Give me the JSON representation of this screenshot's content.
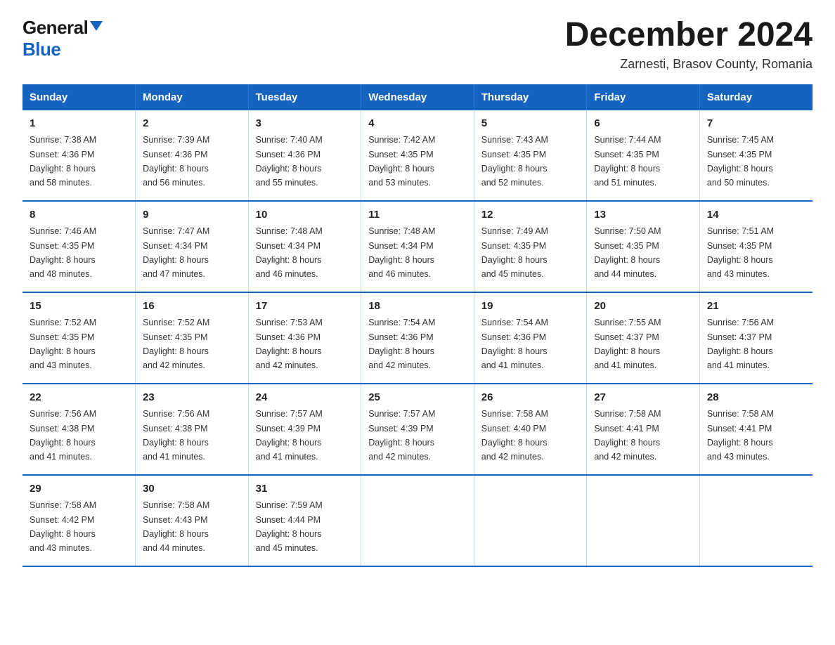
{
  "header": {
    "logo_general": "General",
    "logo_blue": "Blue",
    "title": "December 2024",
    "location": "Zarnesti, Brasov County, Romania"
  },
  "days_of_week": [
    "Sunday",
    "Monday",
    "Tuesday",
    "Wednesday",
    "Thursday",
    "Friday",
    "Saturday"
  ],
  "weeks": [
    [
      {
        "day": "1",
        "sunrise": "7:38 AM",
        "sunset": "4:36 PM",
        "daylight": "8 hours and 58 minutes."
      },
      {
        "day": "2",
        "sunrise": "7:39 AM",
        "sunset": "4:36 PM",
        "daylight": "8 hours and 56 minutes."
      },
      {
        "day": "3",
        "sunrise": "7:40 AM",
        "sunset": "4:36 PM",
        "daylight": "8 hours and 55 minutes."
      },
      {
        "day": "4",
        "sunrise": "7:42 AM",
        "sunset": "4:35 PM",
        "daylight": "8 hours and 53 minutes."
      },
      {
        "day": "5",
        "sunrise": "7:43 AM",
        "sunset": "4:35 PM",
        "daylight": "8 hours and 52 minutes."
      },
      {
        "day": "6",
        "sunrise": "7:44 AM",
        "sunset": "4:35 PM",
        "daylight": "8 hours and 51 minutes."
      },
      {
        "day": "7",
        "sunrise": "7:45 AM",
        "sunset": "4:35 PM",
        "daylight": "8 hours and 50 minutes."
      }
    ],
    [
      {
        "day": "8",
        "sunrise": "7:46 AM",
        "sunset": "4:35 PM",
        "daylight": "8 hours and 48 minutes."
      },
      {
        "day": "9",
        "sunrise": "7:47 AM",
        "sunset": "4:34 PM",
        "daylight": "8 hours and 47 minutes."
      },
      {
        "day": "10",
        "sunrise": "7:48 AM",
        "sunset": "4:34 PM",
        "daylight": "8 hours and 46 minutes."
      },
      {
        "day": "11",
        "sunrise": "7:48 AM",
        "sunset": "4:34 PM",
        "daylight": "8 hours and 46 minutes."
      },
      {
        "day": "12",
        "sunrise": "7:49 AM",
        "sunset": "4:35 PM",
        "daylight": "8 hours and 45 minutes."
      },
      {
        "day": "13",
        "sunrise": "7:50 AM",
        "sunset": "4:35 PM",
        "daylight": "8 hours and 44 minutes."
      },
      {
        "day": "14",
        "sunrise": "7:51 AM",
        "sunset": "4:35 PM",
        "daylight": "8 hours and 43 minutes."
      }
    ],
    [
      {
        "day": "15",
        "sunrise": "7:52 AM",
        "sunset": "4:35 PM",
        "daylight": "8 hours and 43 minutes."
      },
      {
        "day": "16",
        "sunrise": "7:52 AM",
        "sunset": "4:35 PM",
        "daylight": "8 hours and 42 minutes."
      },
      {
        "day": "17",
        "sunrise": "7:53 AM",
        "sunset": "4:36 PM",
        "daylight": "8 hours and 42 minutes."
      },
      {
        "day": "18",
        "sunrise": "7:54 AM",
        "sunset": "4:36 PM",
        "daylight": "8 hours and 42 minutes."
      },
      {
        "day": "19",
        "sunrise": "7:54 AM",
        "sunset": "4:36 PM",
        "daylight": "8 hours and 41 minutes."
      },
      {
        "day": "20",
        "sunrise": "7:55 AM",
        "sunset": "4:37 PM",
        "daylight": "8 hours and 41 minutes."
      },
      {
        "day": "21",
        "sunrise": "7:56 AM",
        "sunset": "4:37 PM",
        "daylight": "8 hours and 41 minutes."
      }
    ],
    [
      {
        "day": "22",
        "sunrise": "7:56 AM",
        "sunset": "4:38 PM",
        "daylight": "8 hours and 41 minutes."
      },
      {
        "day": "23",
        "sunrise": "7:56 AM",
        "sunset": "4:38 PM",
        "daylight": "8 hours and 41 minutes."
      },
      {
        "day": "24",
        "sunrise": "7:57 AM",
        "sunset": "4:39 PM",
        "daylight": "8 hours and 41 minutes."
      },
      {
        "day": "25",
        "sunrise": "7:57 AM",
        "sunset": "4:39 PM",
        "daylight": "8 hours and 42 minutes."
      },
      {
        "day": "26",
        "sunrise": "7:58 AM",
        "sunset": "4:40 PM",
        "daylight": "8 hours and 42 minutes."
      },
      {
        "day": "27",
        "sunrise": "7:58 AM",
        "sunset": "4:41 PM",
        "daylight": "8 hours and 42 minutes."
      },
      {
        "day": "28",
        "sunrise": "7:58 AM",
        "sunset": "4:41 PM",
        "daylight": "8 hours and 43 minutes."
      }
    ],
    [
      {
        "day": "29",
        "sunrise": "7:58 AM",
        "sunset": "4:42 PM",
        "daylight": "8 hours and 43 minutes."
      },
      {
        "day": "30",
        "sunrise": "7:58 AM",
        "sunset": "4:43 PM",
        "daylight": "8 hours and 44 minutes."
      },
      {
        "day": "31",
        "sunrise": "7:59 AM",
        "sunset": "4:44 PM",
        "daylight": "8 hours and 45 minutes."
      },
      null,
      null,
      null,
      null
    ]
  ],
  "labels": {
    "sunrise": "Sunrise:",
    "sunset": "Sunset:",
    "daylight": "Daylight:"
  }
}
